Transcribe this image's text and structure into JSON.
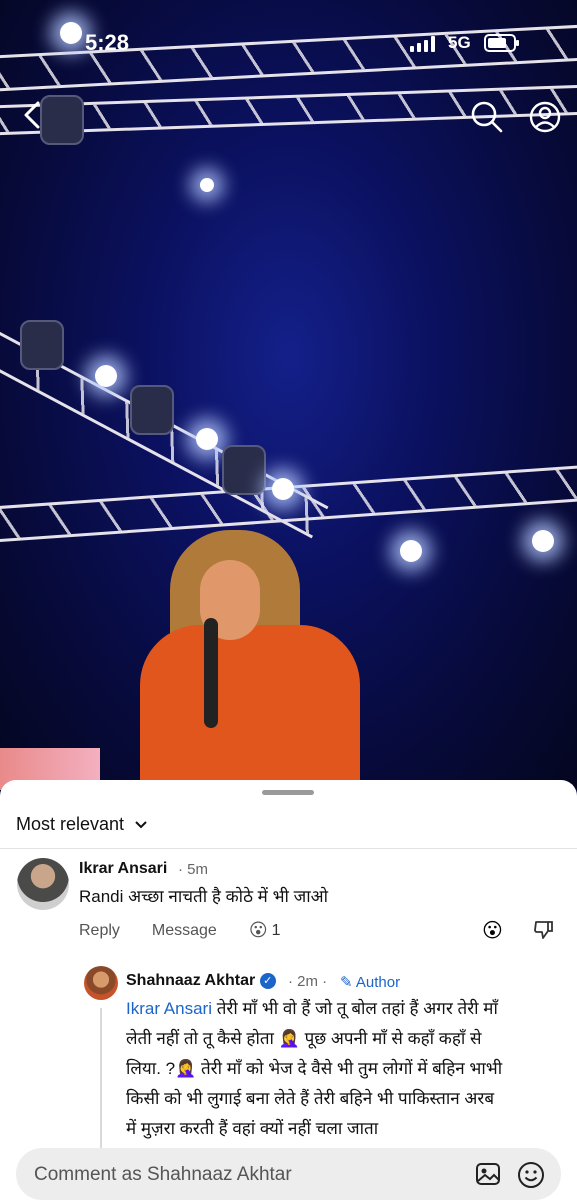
{
  "status_bar": {
    "time": "5:28",
    "network": "5G"
  },
  "comments": {
    "sort_label": "Most relevant",
    "items": [
      {
        "author": "Ikrar Ansari",
        "time": "5m",
        "text": "Randi अच्छा नाचती है कोठे में भी जाओ",
        "reply_label": "Reply",
        "message_label": "Message",
        "reaction_emoji": "😮",
        "reaction_count": "1"
      }
    ],
    "reply": {
      "author": "Shahnaaz Akhtar",
      "time": "2m",
      "author_badge": "Author",
      "mention": "Ikrar Ansari",
      "text_line1": " तेरी  माँ भी वो हैं जो तू बोल तहां हैं अगर तेरी माँ",
      "text_line2": "लेती  नहीं तो तू कैसे होता 🤦‍♀️ पूछ अपनी माँ से कहाँ कहाँ से",
      "text_line3": "लिया. ?🤦‍♀️ तेरी माँ को भेज दे वैसे भी तुम लोगों में बहिन भाभी",
      "text_line4": "किसी को भी लुगाई बना लेते हैं तेरी बहिने भी पाकिस्तान अरब",
      "text_line5": "में मुज़रा करती हैं वहां क्यों नहीं चला जाता"
    }
  },
  "composer": {
    "placeholder": "Comment as Shahnaaz Akhtar"
  },
  "colors": {
    "link": "#1d64c8",
    "sheet": "#ffffff",
    "video_bg": "#0b1160"
  }
}
